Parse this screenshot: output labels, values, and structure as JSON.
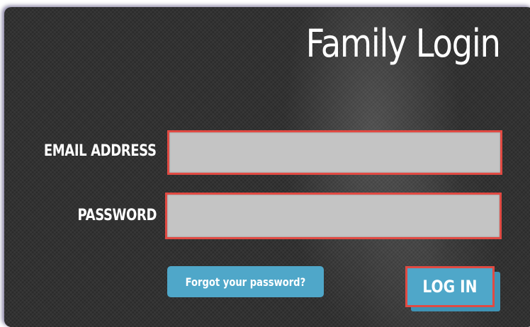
{
  "form": {
    "title": "Family Login",
    "email_label": "EMAIL ADDRESS",
    "email_value": "",
    "email_placeholder": "",
    "password_label": "PASSWORD",
    "password_value": "",
    "password_placeholder": "",
    "forgot_label": "Forgot your password?",
    "login_label": "LOG IN"
  },
  "colors": {
    "panel_background": "#2a2a2a",
    "field_background": "#c4c4c4",
    "highlight_border": "#e04a43",
    "button_background": "#4fa7c9",
    "text": "#ffffff"
  }
}
